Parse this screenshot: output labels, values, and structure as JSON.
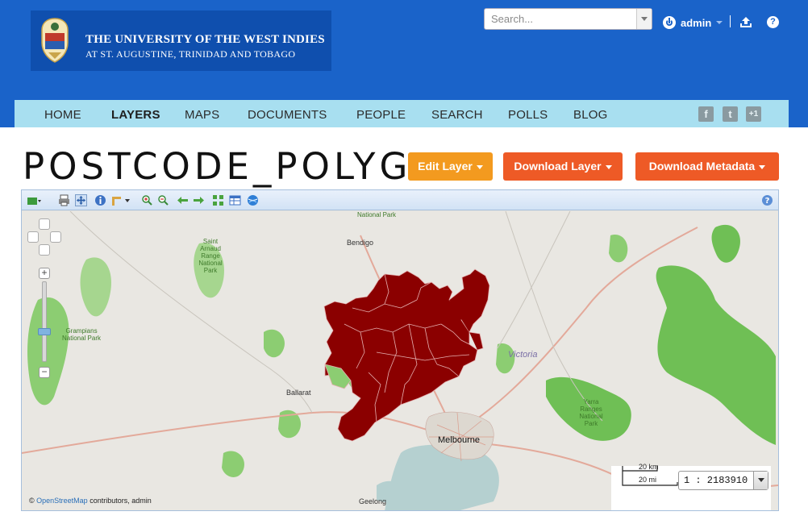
{
  "header": {
    "university_line1": "THE UNIVERSITY OF THE WEST INDIES",
    "university_line2": "AT ST. AUGUSTINE, TRINIDAD AND TOBAGO",
    "search_placeholder": "Search...",
    "user_name": "admin",
    "help_glyph": "?"
  },
  "nav": {
    "items": [
      {
        "label": "HOME"
      },
      {
        "label": "LAYERS",
        "active": true
      },
      {
        "label": "MAPS"
      },
      {
        "label": "DOCUMENTS"
      },
      {
        "label": "PEOPLE"
      },
      {
        "label": "SEARCH"
      },
      {
        "label": "POLLS"
      },
      {
        "label": "BLOG"
      }
    ],
    "social": [
      {
        "icon": "facebook-icon",
        "glyph": "f"
      },
      {
        "icon": "twitter-icon",
        "glyph": "t"
      },
      {
        "icon": "google-plus-icon",
        "glyph": "+1"
      }
    ]
  },
  "layer": {
    "title": "POSTCODE_POLYG",
    "edit_label": "Edit Layer",
    "download_label": "Download Layer",
    "metadata_label": "Download Metadata"
  },
  "map": {
    "labels": {
      "bendigo": "Bendigo",
      "ballarat": "Ballarat",
      "melbourne": "Melbourne",
      "geelong": "Geelong",
      "victoria": "Victoria",
      "park_top": "National Park",
      "st_arnaud": "Saint Arnaud Range National Park",
      "grampians": "Grampians National Park",
      "yarra": "Yarra Ranges National Park"
    },
    "scale_line_top": "20 km",
    "scale_line_bottom": "20 mi",
    "scale_ratio": "1 : 2183910",
    "attribution_prefix": "©",
    "attribution_link": "OpenStreetMap",
    "attribution_suffix": "contributors, admin",
    "colors": {
      "polygon_fill": "#8b0000",
      "park_green": "#6fbf55",
      "water": "#b5d0d0",
      "land": "#e5e3df"
    }
  }
}
